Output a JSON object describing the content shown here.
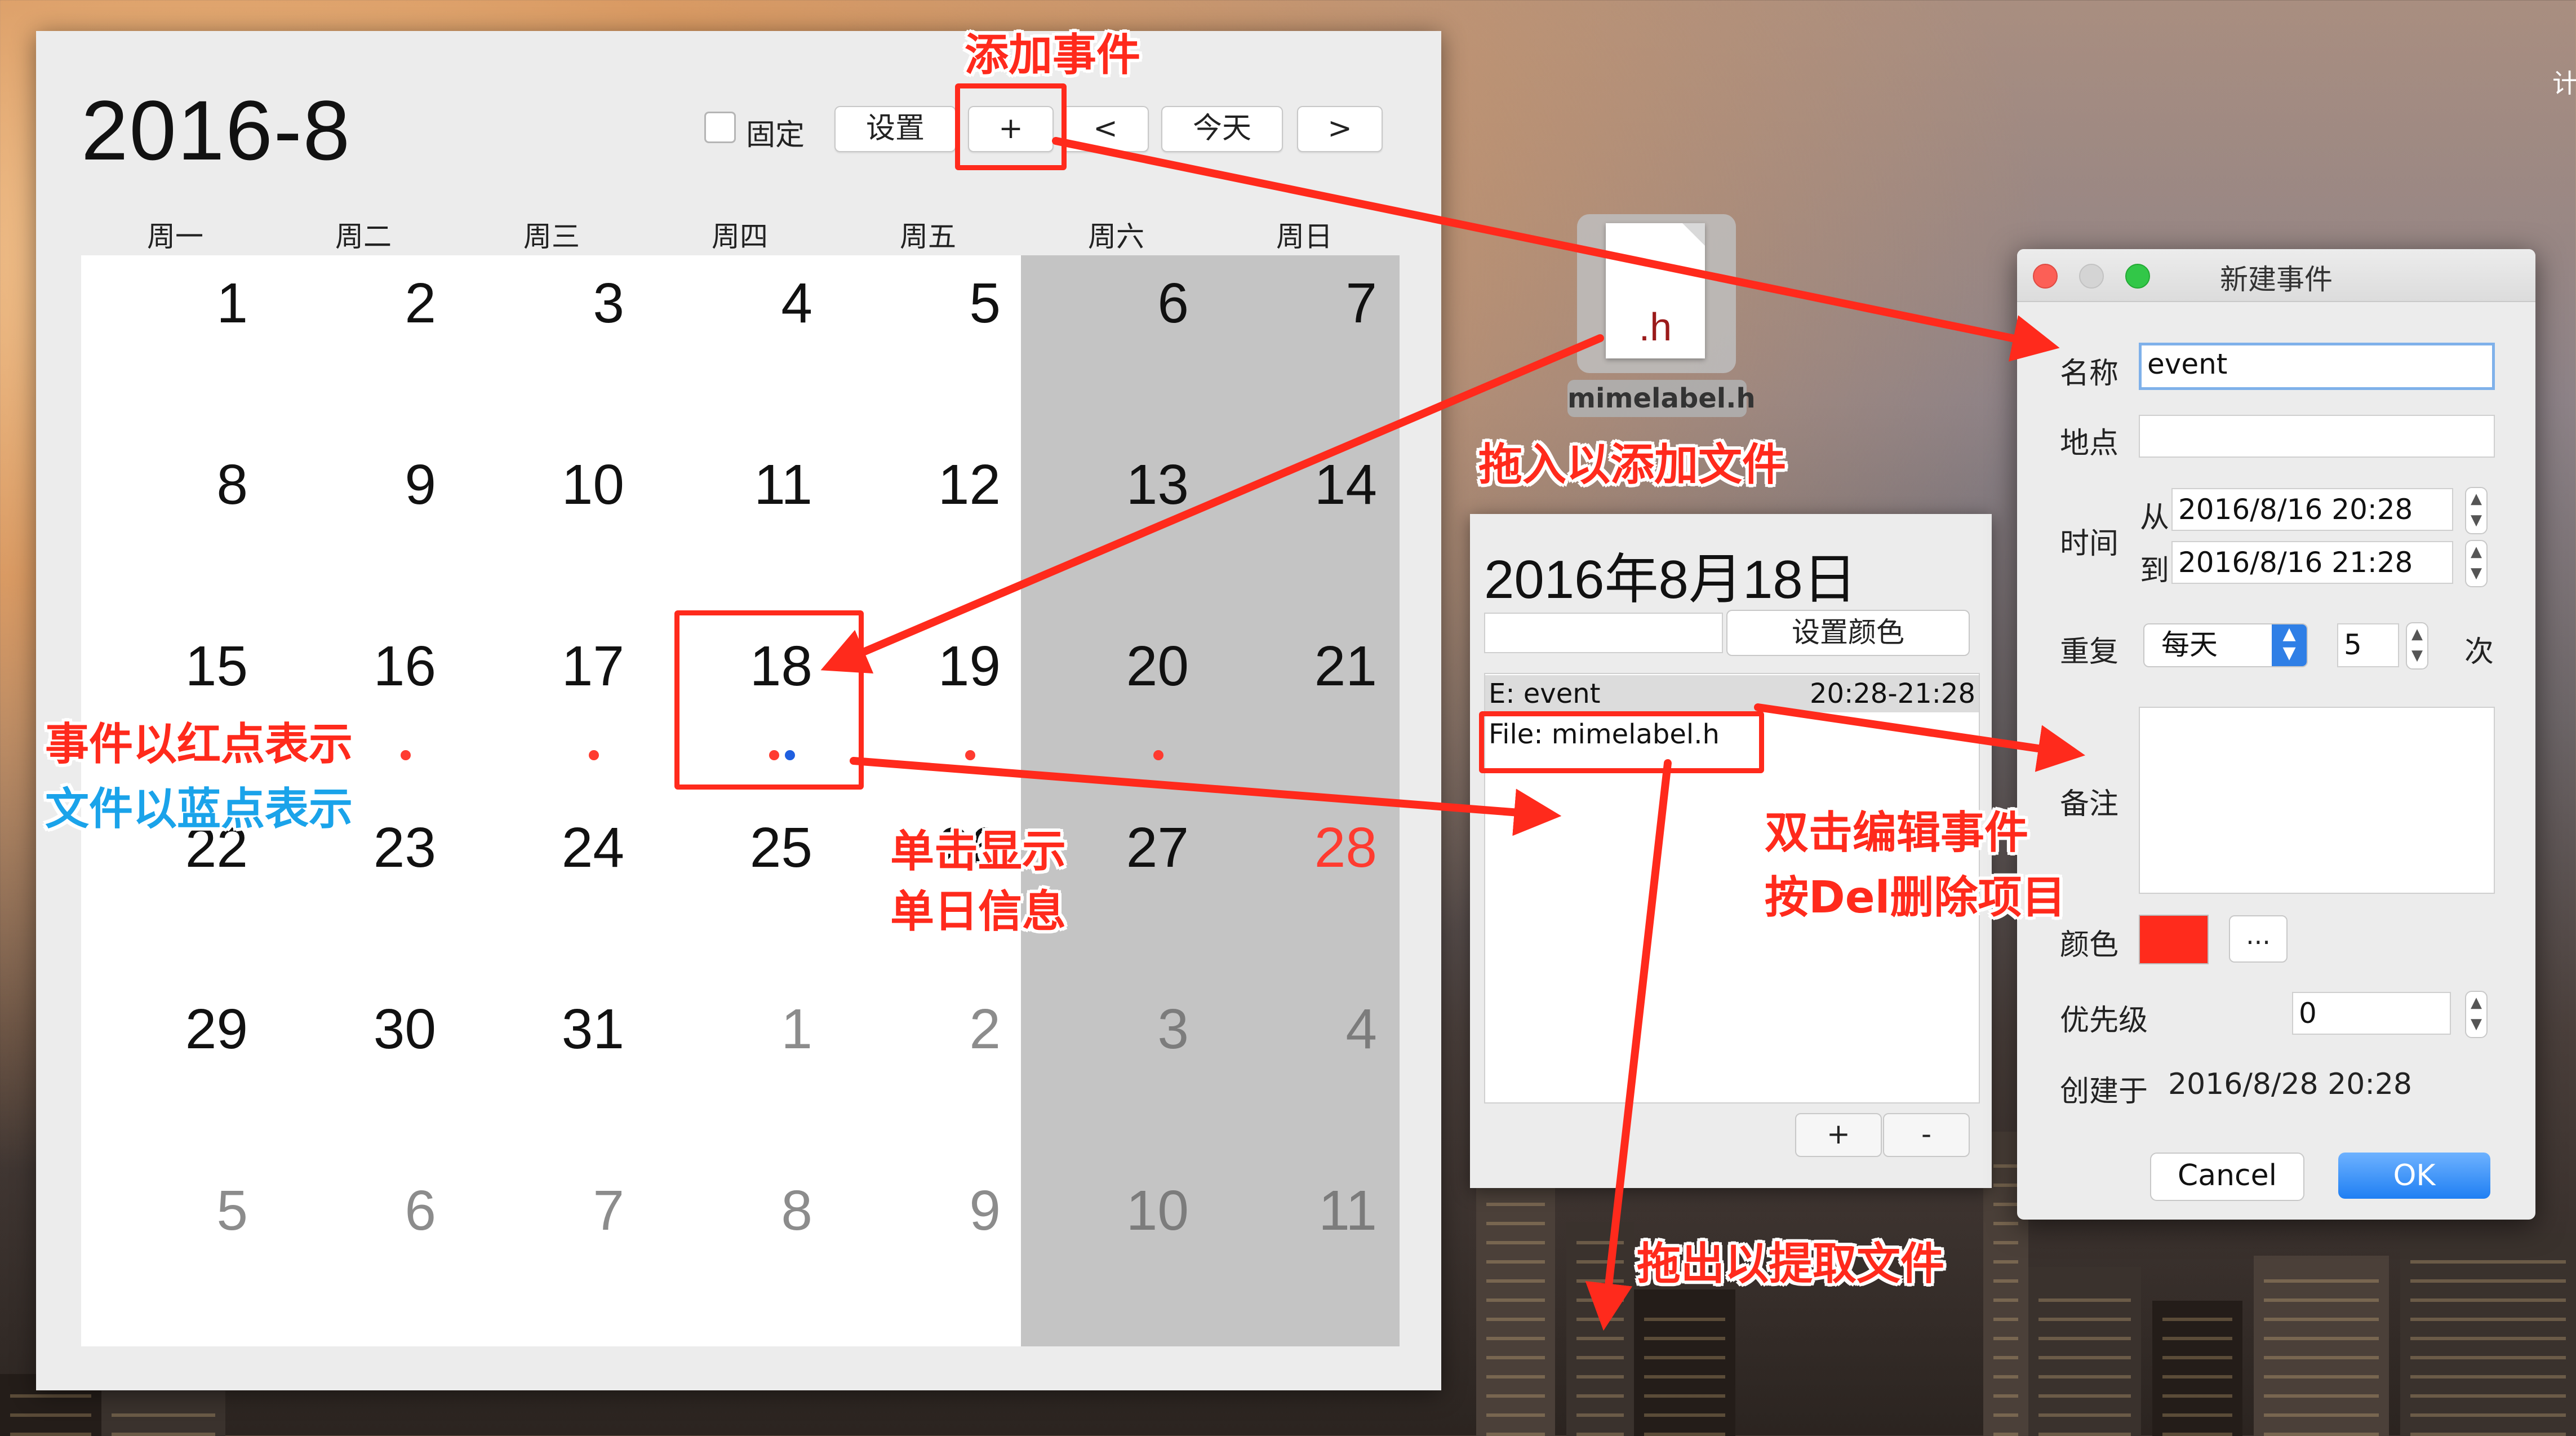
{
  "calendar": {
    "title": "2016-8",
    "pin_label": "固定",
    "settings_label": "设置",
    "add_label": "+",
    "prev_label": "<",
    "today_label": "今天",
    "next_label": ">",
    "weekdays": [
      "周一",
      "周二",
      "周三",
      "周四",
      "周五",
      "周六",
      "周日"
    ],
    "weeks": [
      [
        {
          "d": "1"
        },
        {
          "d": "2"
        },
        {
          "d": "3"
        },
        {
          "d": "4"
        },
        {
          "d": "5"
        },
        {
          "d": "6"
        },
        {
          "d": "7"
        }
      ],
      [
        {
          "d": "8"
        },
        {
          "d": "9"
        },
        {
          "d": "10"
        },
        {
          "d": "11"
        },
        {
          "d": "12"
        },
        {
          "d": "13"
        },
        {
          "d": "14"
        }
      ],
      [
        {
          "d": "15"
        },
        {
          "d": "16",
          "dots": [
            "red"
          ]
        },
        {
          "d": "17",
          "dots": [
            "red"
          ]
        },
        {
          "d": "18",
          "dots": [
            "red",
            "blue"
          ]
        },
        {
          "d": "19",
          "dots": [
            "red"
          ]
        },
        {
          "d": "20",
          "dots": [
            "red"
          ]
        },
        {
          "d": "21"
        }
      ],
      [
        {
          "d": "22"
        },
        {
          "d": "23"
        },
        {
          "d": "24"
        },
        {
          "d": "25"
        },
        {
          "d": "26"
        },
        {
          "d": "27"
        },
        {
          "d": "28",
          "today": true
        }
      ],
      [
        {
          "d": "29"
        },
        {
          "d": "30"
        },
        {
          "d": "31"
        },
        {
          "d": "1",
          "other": true
        },
        {
          "d": "2",
          "other": true
        },
        {
          "d": "3",
          "other": true
        },
        {
          "d": "4",
          "other": true
        }
      ],
      [
        {
          "d": "5",
          "other": true
        },
        {
          "d": "6",
          "other": true
        },
        {
          "d": "7",
          "other": true
        },
        {
          "d": "8",
          "other": true
        },
        {
          "d": "9",
          "other": true
        },
        {
          "d": "10",
          "other": true
        },
        {
          "d": "11",
          "other": true
        }
      ]
    ]
  },
  "colors": {
    "event_dot": "#ff3b30",
    "file_dot": "#1f5fe0",
    "accent": "#ff2a1c",
    "ok_button": "#1f7ff3"
  },
  "file_icon": {
    "ext": ".h",
    "name": "mimelabel.h"
  },
  "day_panel": {
    "title": "2016年8月18日",
    "input_value": "",
    "set_color_label": "设置颜色",
    "items": [
      {
        "label": "E:  event",
        "time": "20:28-21:28"
      },
      {
        "label": "File: mimelabel.h",
        "time": ""
      }
    ],
    "add_label": "+",
    "delete_label": "-"
  },
  "dialog": {
    "title": "新建事件",
    "name_label": "名称",
    "name_value": "event",
    "location_label": "地点",
    "location_value": "",
    "time_label": "时间",
    "from_label": "从",
    "from_value": "2016/8/16 20:28",
    "to_label": "到",
    "to_value": "2016/8/16 21:28",
    "repeat_label": "重复",
    "repeat_value": "每天",
    "repeat_count": "5",
    "repeat_unit": "次",
    "note_label": "备注",
    "note_value": "",
    "color_label": "颜色",
    "color_value": "#ff2b1c",
    "more_label": "...",
    "priority_label": "优先级",
    "priority_value": "0",
    "created_label": "创建于",
    "created_value": "2016/8/28 20:28",
    "cancel_label": "Cancel",
    "ok_label": "OK"
  },
  "annotations": {
    "add_event": "添加事件",
    "drag_in": "拖入以添加文件",
    "event_red": "事件以红点表示",
    "file_blue": "文件以蓝点表示",
    "click_show_1": "单击显示",
    "click_show_2": "单日信息",
    "dblclick": "双击编辑事件",
    "del": "按Del删除项目",
    "drag_out": "拖出以提取文件"
  },
  "desktop": {
    "corner_text": "计"
  }
}
